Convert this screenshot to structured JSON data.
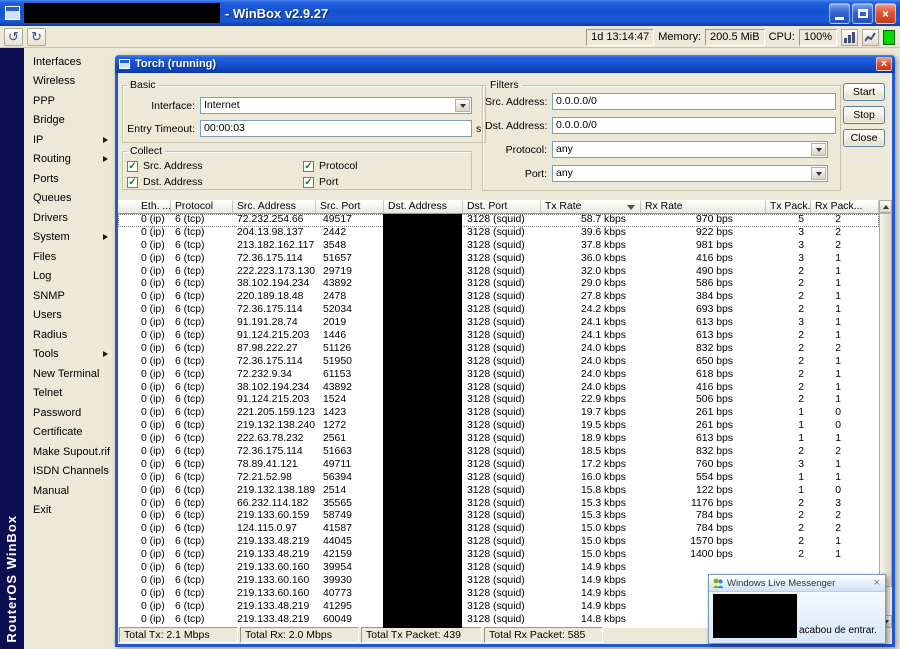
{
  "window": {
    "title": "- WinBox v2.9.27"
  },
  "toolbar": {
    "undo_icon": "↺",
    "redo_icon": "↻"
  },
  "statusbar": {
    "uptime": "1d 13:14:47",
    "memory_label": "Memory:",
    "memory_value": "200.5 MiB",
    "cpu_label": "CPU:",
    "cpu_value": "100%"
  },
  "brand": "RouterOS WinBox",
  "sidebar": {
    "items": [
      {
        "label": "Interfaces",
        "submenu": false
      },
      {
        "label": "Wireless",
        "submenu": false
      },
      {
        "label": "PPP",
        "submenu": false
      },
      {
        "label": "Bridge",
        "submenu": false
      },
      {
        "label": "IP",
        "submenu": true
      },
      {
        "label": "Routing",
        "submenu": true
      },
      {
        "label": "Ports",
        "submenu": false
      },
      {
        "label": "Queues",
        "submenu": false
      },
      {
        "label": "Drivers",
        "submenu": false
      },
      {
        "label": "System",
        "submenu": true
      },
      {
        "label": "Files",
        "submenu": false
      },
      {
        "label": "Log",
        "submenu": false
      },
      {
        "label": "SNMP",
        "submenu": false
      },
      {
        "label": "Users",
        "submenu": false
      },
      {
        "label": "Radius",
        "submenu": false
      },
      {
        "label": "Tools",
        "submenu": true
      },
      {
        "label": "New Terminal",
        "submenu": false
      },
      {
        "label": "Telnet",
        "submenu": false
      },
      {
        "label": "Password",
        "submenu": false
      },
      {
        "label": "Certificate",
        "submenu": false
      },
      {
        "label": "Make Supout.rif",
        "submenu": false
      },
      {
        "label": "ISDN Channels",
        "submenu": false
      },
      {
        "label": "Manual",
        "submenu": false
      },
      {
        "label": "Exit",
        "submenu": false
      }
    ]
  },
  "torch": {
    "title": "Torch (running)",
    "basic": {
      "legend": "Basic",
      "interface_label": "Interface:",
      "interface_value": "Internet",
      "entry_timeout_label": "Entry Timeout:",
      "entry_timeout_value": "00:00:03",
      "entry_timeout_suffix": "s"
    },
    "filters": {
      "legend": "Filters",
      "src_label": "Src. Address:",
      "src_value": "0.0.0.0/0",
      "dst_label": "Dst. Address:",
      "dst_value": "0.0.0.0/0",
      "protocol_label": "Protocol:",
      "protocol_value": "any",
      "port_label": "Port:",
      "port_value": "any"
    },
    "buttons": {
      "start": "Start",
      "stop": "Stop",
      "close": "Close"
    },
    "collect": {
      "legend": "Collect",
      "checkboxes": [
        {
          "label": "Src. Address",
          "checked": true
        },
        {
          "label": "Protocol",
          "checked": true
        },
        {
          "label": "Dst. Address",
          "checked": true
        },
        {
          "label": "Port",
          "checked": true
        }
      ]
    },
    "table": {
      "columns": [
        "Eth. ...",
        "Protocol",
        "Src. Address",
        "Src. Port",
        "Dst. Address",
        "Dst. Port",
        "Tx Rate",
        "Rx Rate",
        "Tx Pack...",
        "Rx Pack..."
      ],
      "sort_column": 6,
      "rows": [
        [
          "0 (ip)",
          "6 (tcp)",
          "72.232.254.66",
          "49517",
          "3128 (squid)",
          "58.7 kbps",
          "970 bps",
          "5",
          "2"
        ],
        [
          "0 (ip)",
          "6 (tcp)",
          "204.13.98.137",
          "2442",
          "3128 (squid)",
          "39.6 kbps",
          "922 bps",
          "3",
          "2"
        ],
        [
          "0 (ip)",
          "6 (tcp)",
          "213.182.162.117",
          "3548",
          "3128 (squid)",
          "37.8 kbps",
          "981 bps",
          "3",
          "2"
        ],
        [
          "0 (ip)",
          "6 (tcp)",
          "72.36.175.114",
          "51657",
          "3128 (squid)",
          "36.0 kbps",
          "416 bps",
          "3",
          "1"
        ],
        [
          "0 (ip)",
          "6 (tcp)",
          "222.223.173.130",
          "29719",
          "3128 (squid)",
          "32.0 kbps",
          "490 bps",
          "2",
          "1"
        ],
        [
          "0 (ip)",
          "6 (tcp)",
          "38.102.194.234",
          "43892",
          "3128 (squid)",
          "29.0 kbps",
          "586 bps",
          "2",
          "1"
        ],
        [
          "0 (ip)",
          "6 (tcp)",
          "220.189.18.48",
          "2478",
          "3128 (squid)",
          "27.8 kbps",
          "384 bps",
          "2",
          "1"
        ],
        [
          "0 (ip)",
          "6 (tcp)",
          "72.36.175.114",
          "52034",
          "3128 (squid)",
          "24.2 kbps",
          "693 bps",
          "2",
          "1"
        ],
        [
          "0 (ip)",
          "6 (tcp)",
          "91.191.28.74",
          "2019",
          "3128 (squid)",
          "24.1 kbps",
          "613 bps",
          "3",
          "1"
        ],
        [
          "0 (ip)",
          "6 (tcp)",
          "91.124.215.203",
          "1446",
          "3128 (squid)",
          "24.1 kbps",
          "613 bps",
          "2",
          "1"
        ],
        [
          "0 (ip)",
          "6 (tcp)",
          "87.98.222.27",
          "51126",
          "3128 (squid)",
          "24.0 kbps",
          "832 bps",
          "2",
          "2"
        ],
        [
          "0 (ip)",
          "6 (tcp)",
          "72.36.175.114",
          "51950",
          "3128 (squid)",
          "24.0 kbps",
          "650 bps",
          "2",
          "1"
        ],
        [
          "0 (ip)",
          "6 (tcp)",
          "72.232.9.34",
          "61153",
          "3128 (squid)",
          "24.0 kbps",
          "618 bps",
          "2",
          "1"
        ],
        [
          "0 (ip)",
          "6 (tcp)",
          "38.102.194.234",
          "43892",
          "3128 (squid)",
          "24.0 kbps",
          "416 bps",
          "2",
          "1"
        ],
        [
          "0 (ip)",
          "6 (tcp)",
          "91.124.215.203",
          "1524",
          "3128 (squid)",
          "22.9 kbps",
          "506 bps",
          "2",
          "1"
        ],
        [
          "0 (ip)",
          "6 (tcp)",
          "221.205.159.123",
          "1423",
          "3128 (squid)",
          "19.7 kbps",
          "261 bps",
          "1",
          "0"
        ],
        [
          "0 (ip)",
          "6 (tcp)",
          "219.132.138.240",
          "1272",
          "3128 (squid)",
          "19.5 kbps",
          "261 bps",
          "1",
          "0"
        ],
        [
          "0 (ip)",
          "6 (tcp)",
          "222.63.78.232",
          "2561",
          "3128 (squid)",
          "18.9 kbps",
          "613 bps",
          "1",
          "1"
        ],
        [
          "0 (ip)",
          "6 (tcp)",
          "72.36.175.114",
          "51663",
          "3128 (squid)",
          "18.5 kbps",
          "832 bps",
          "2",
          "2"
        ],
        [
          "0 (ip)",
          "6 (tcp)",
          "78.89.41.121",
          "49711",
          "3128 (squid)",
          "17.2 kbps",
          "760 bps",
          "3",
          "1"
        ],
        [
          "0 (ip)",
          "6 (tcp)",
          "72.21.52.98",
          "56394",
          "3128 (squid)",
          "16.0 kbps",
          "554 bps",
          "1",
          "1"
        ],
        [
          "0 (ip)",
          "6 (tcp)",
          "219.132.138.189",
          "2514",
          "3128 (squid)",
          "15.8 kbps",
          "122 bps",
          "1",
          "0"
        ],
        [
          "0 (ip)",
          "6 (tcp)",
          "66.232.114.182",
          "35565",
          "3128 (squid)",
          "15.3 kbps",
          "1176 bps",
          "2",
          "3"
        ],
        [
          "0 (ip)",
          "6 (tcp)",
          "219.133.60.159",
          "58749",
          "3128 (squid)",
          "15.3 kbps",
          "784 bps",
          "2",
          "2"
        ],
        [
          "0 (ip)",
          "6 (tcp)",
          "124.115.0.97",
          "41587",
          "3128 (squid)",
          "15.0 kbps",
          "784 bps",
          "2",
          "2"
        ],
        [
          "0 (ip)",
          "6 (tcp)",
          "219.133.48.219",
          "44045",
          "3128 (squid)",
          "15.0 kbps",
          "1570 bps",
          "2",
          "1"
        ],
        [
          "0 (ip)",
          "6 (tcp)",
          "219.133.48.219",
          "42159",
          "3128 (squid)",
          "15.0 kbps",
          "1400 bps",
          "2",
          "1"
        ],
        [
          "0 (ip)",
          "6 (tcp)",
          "219.133.60.160",
          "39954",
          "3128 (squid)",
          "14.9 kbps",
          "",
          "",
          ""
        ],
        [
          "0 (ip)",
          "6 (tcp)",
          "219.133.60.160",
          "39930",
          "3128 (squid)",
          "14.9 kbps",
          "",
          "",
          ""
        ],
        [
          "0 (ip)",
          "6 (tcp)",
          "219.133.60.160",
          "40773",
          "3128 (squid)",
          "14.9 kbps",
          "",
          "",
          ""
        ],
        [
          "0 (ip)",
          "6 (tcp)",
          "219.133.48.219",
          "41295",
          "3128 (squid)",
          "14.9 kbps",
          "",
          "",
          ""
        ],
        [
          "0 (ip)",
          "6 (tcp)",
          "219.133.48.219",
          "60049",
          "3128 (squid)",
          "14.8 kbps",
          "",
          "",
          ""
        ]
      ]
    },
    "totals": [
      "Total Tx: 2.1 Mbps",
      "Total Rx: 2.0 Mbps",
      "Total Tx Packet: 439",
      "Total Rx Packet: 585"
    ]
  },
  "messenger": {
    "title": "Windows Live Messenger",
    "message": "acabou de entrar."
  },
  "colors": {
    "titlebar_blue": "#1a52d1",
    "window_beige": "#ECE9D8",
    "led_green": "#00dc00",
    "close_red": "#d54324",
    "redaction_black": "#000000"
  }
}
